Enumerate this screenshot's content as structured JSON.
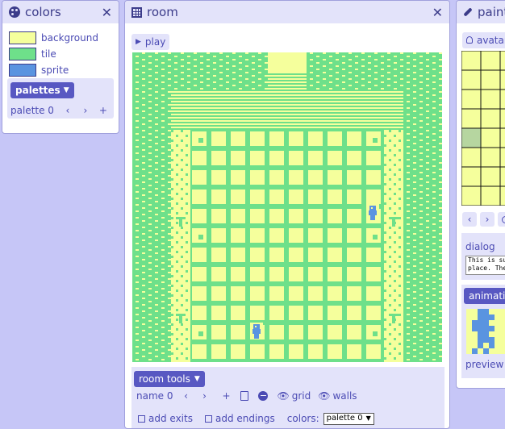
{
  "colors_panel": {
    "title": "colors",
    "items": [
      {
        "label": "background",
        "color": "#f5ff9c"
      },
      {
        "label": "tile",
        "color": "#6ee08a"
      },
      {
        "label": "sprite",
        "color": "#5a94e0"
      }
    ],
    "palettes_label": "palettes",
    "palette_name": "palette 0"
  },
  "room_panel": {
    "title": "room",
    "play_label": "play",
    "tools_label": "room tools",
    "name_label": "name 0",
    "grid_label": "grid",
    "walls_label": "walls",
    "add_exits_label": "add exits",
    "add_endings_label": "add endings",
    "colors_label": "colors:",
    "palette_select": "palette 0"
  },
  "paint_panel": {
    "title": "paint",
    "avatar_label": "avatar",
    "dialog_label": "dialog",
    "dialog_text_line1": "This is su",
    "dialog_text_line2": "place. The",
    "animation_label": "animation",
    "preview_label": "preview"
  }
}
